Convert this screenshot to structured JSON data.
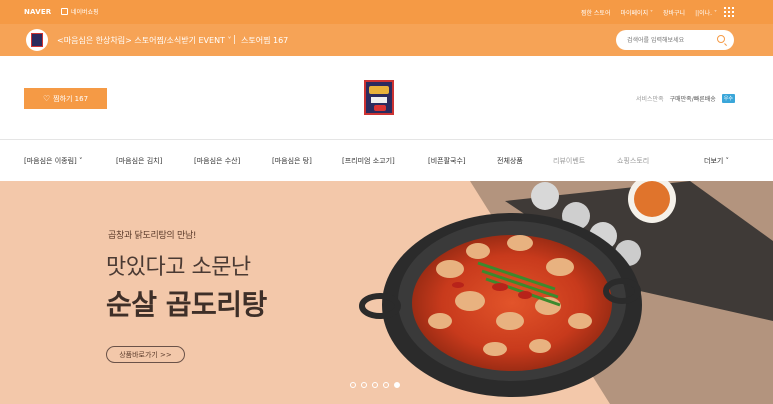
{
  "topbar": {
    "naver": "NAVER",
    "shopping": "네이버쇼핑",
    "links": [
      "찜한 스토어",
      "마이페이지 ˅",
      "장바구니",
      "||이나. ˅"
    ]
  },
  "store": {
    "name": "<마음심은 한상차림> 스토어찜/소식받기 EVENT ˅",
    "fav_count": "스토어찜 167",
    "search_placeholder": "검색어를 입력해보세요"
  },
  "header": {
    "fav_button": "찜하기 167",
    "service_label": "서비스만족",
    "service_spec": "구매만족/빠른배송",
    "service_badge": "우수"
  },
  "nav": {
    "items": [
      {
        "label": "[마음심은 이종림] ˅"
      },
      {
        "label": "[마음심은 김치]"
      },
      {
        "label": "[마음심은 수산]"
      },
      {
        "label": "[마음심은 탕]"
      },
      {
        "label": "[프리미엄 소고기]"
      },
      {
        "label": "[비픈팔국수]"
      },
      {
        "label": "전체상품"
      },
      {
        "label": "리뷰이벤트"
      },
      {
        "label": "쇼핑스토리"
      }
    ],
    "more": "더보기 ˅"
  },
  "banner": {
    "subtitle": "곱창과 닭도리탕의 만남!",
    "title_line1": "맛있다고 소문난",
    "title_line2": "순살 곱도리탕",
    "cta": "상품바로가기 >>",
    "slides": 5,
    "active_slide": 5
  }
}
